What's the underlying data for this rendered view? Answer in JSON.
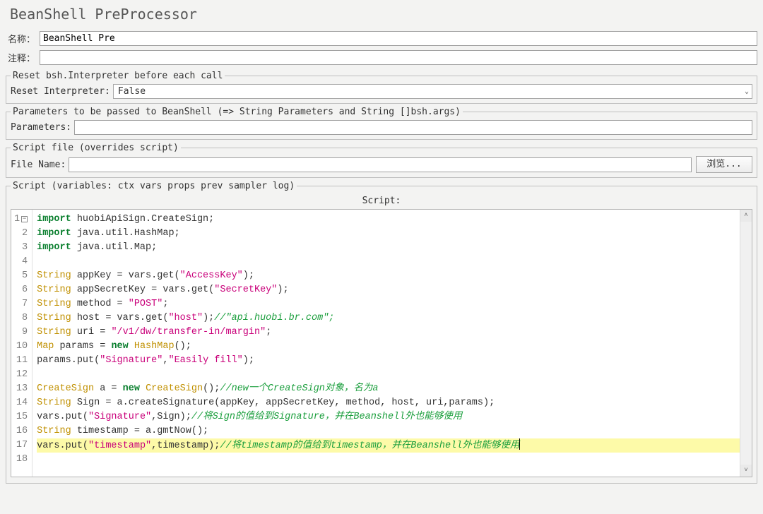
{
  "title": "BeanShell PreProcessor",
  "fields": {
    "name_label": "名称：",
    "name_value": "BeanShell Pre",
    "comments_label": "注释：",
    "comments_value": ""
  },
  "reset_group": {
    "legend": "Reset bsh.Interpreter before each call",
    "label": "Reset Interpreter:",
    "value": "False"
  },
  "params_group": {
    "legend": "Parameters to be passed to BeanShell (=> String Parameters and String []bsh.args)",
    "label": "Parameters:",
    "value": ""
  },
  "scriptfile_group": {
    "legend": "Script file (overrides script)",
    "label": "File Name:",
    "value": "",
    "browse_label": "浏览..."
  },
  "script_group": {
    "legend": "Script (variables: ctx vars props prev sampler log)",
    "header": "Script:"
  },
  "code_lines": [
    "import huobiApiSign.CreateSign;",
    "import java.util.HashMap;",
    "import java.util.Map;",
    "",
    "String appKey = vars.get(\"AccessKey\");",
    "String appSecretKey = vars.get(\"SecretKey\");",
    "String method = \"POST\";",
    "String host = vars.get(\"host\");//\"api.huobi.br.com\";",
    "String uri = \"/v1/dw/transfer-in/margin\";",
    "Map params = new HashMap();",
    "params.put(\"Signature\",\"Easily fill\");",
    "",
    "CreateSign a = new CreateSign();//new一个CreateSign对象，名为a",
    "String Sign = a.createSignature(appKey, appSecretKey, method, host, uri,params);",
    "vars.put(\"Signature\",Sign);//将Sign的值给到Signature，并在Beanshell外也能够使用",
    "String timestamp = a.gmtNow();",
    "vars.put(\"timestamp\",timestamp);//将timestamp的值给到timestamp，并在Beanshell外也能够使用",
    ""
  ],
  "highlight_line": 17
}
